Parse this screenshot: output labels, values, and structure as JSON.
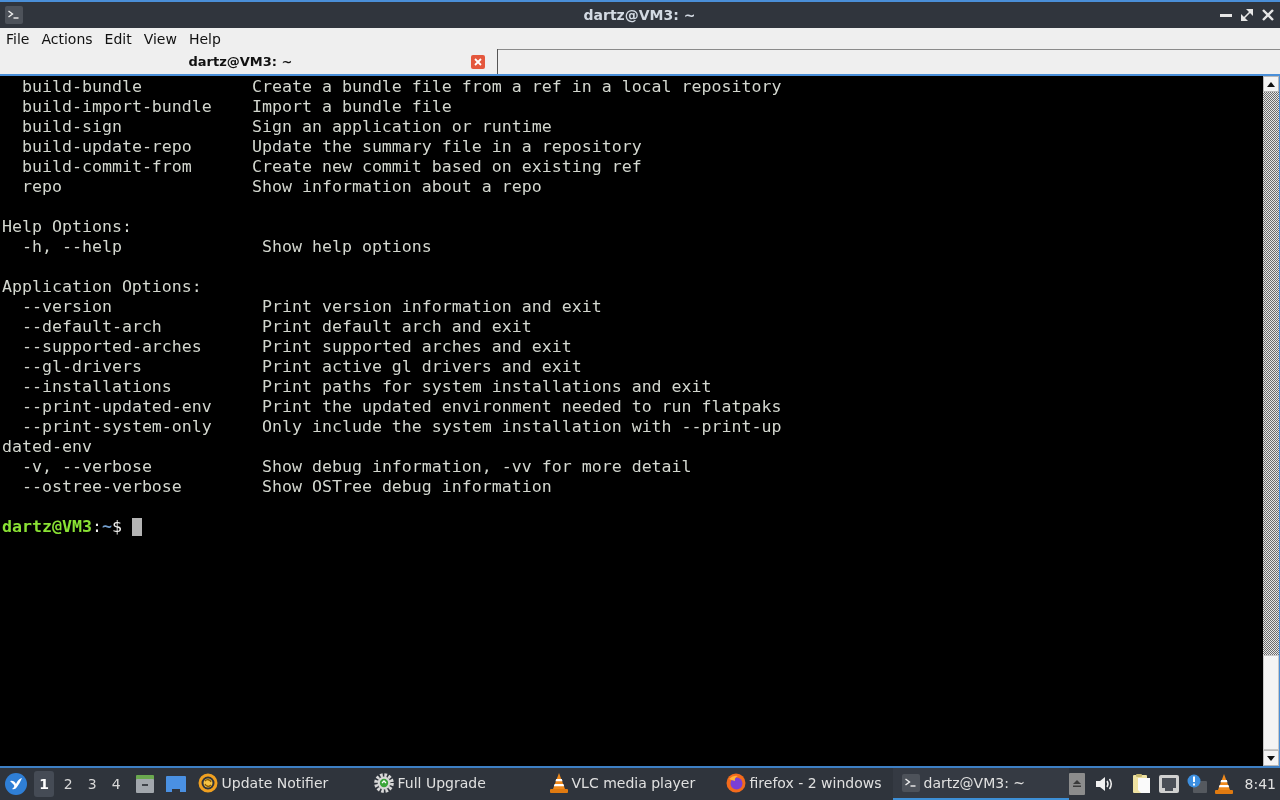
{
  "window": {
    "title": "dartz@VM3: ~"
  },
  "menu": [
    "File",
    "Actions",
    "Edit",
    "View",
    "Help"
  ],
  "tabs": [
    {
      "label": "dartz@VM3: ~",
      "selected": true
    }
  ],
  "terminal": {
    "lines": [
      {
        "kind": "command",
        "name": "build-bundle",
        "description": "Create a bundle file from a ref in a local repository"
      },
      {
        "kind": "command",
        "name": "build-import-bundle",
        "description": "Import a bundle file"
      },
      {
        "kind": "command",
        "name": "build-sign",
        "description": "Sign an application or runtime"
      },
      {
        "kind": "command",
        "name": "build-update-repo",
        "description": "Update the summary file in a repository"
      },
      {
        "kind": "command",
        "name": "build-commit-from",
        "description": "Create new commit based on existing ref"
      },
      {
        "kind": "command",
        "name": "repo",
        "description": "Show information about a repo"
      },
      {
        "kind": "blank"
      },
      {
        "kind": "text",
        "text": "Help Options:"
      },
      {
        "kind": "option",
        "name": "-h, --help",
        "description": "Show help options"
      },
      {
        "kind": "blank"
      },
      {
        "kind": "text",
        "text": "Application Options:"
      },
      {
        "kind": "option",
        "name": "--version",
        "description": "Print version information and exit"
      },
      {
        "kind": "option",
        "name": "--default-arch",
        "description": "Print default arch and exit"
      },
      {
        "kind": "option",
        "name": "--supported-arches",
        "description": "Print supported arches and exit"
      },
      {
        "kind": "option",
        "name": "--gl-drivers",
        "description": "Print active gl drivers and exit"
      },
      {
        "kind": "option",
        "name": "--installations",
        "description": "Print paths for system installations and exit"
      },
      {
        "kind": "option",
        "name": "--print-updated-env",
        "description": "Print the updated environment needed to run flatpaks"
      },
      {
        "kind": "option",
        "name": "--print-system-only",
        "description": "Only include the system installation with --print-up"
      },
      {
        "kind": "text",
        "text": "dated-env"
      },
      {
        "kind": "option",
        "name": "-v, --verbose",
        "description": "Show debug information, -vv for more detail"
      },
      {
        "kind": "option",
        "name": "--ostree-verbose",
        "description": "Show OSTree debug information"
      },
      {
        "kind": "blank"
      }
    ],
    "prompt": {
      "user_host": "dartz@VM3",
      "separator": ":",
      "path": "~",
      "symbol": "$"
    }
  },
  "taskbar": {
    "desktops": [
      {
        "label": "1",
        "selected": true
      },
      {
        "label": "2",
        "selected": false
      },
      {
        "label": "3",
        "selected": false
      },
      {
        "label": "4",
        "selected": false
      }
    ],
    "tasks": [
      {
        "label": "Update Notifier",
        "selected": false
      },
      {
        "label": "Full Upgrade",
        "selected": false
      },
      {
        "label": "VLC media player",
        "selected": false
      },
      {
        "label": "firefox - 2 windows",
        "selected": false
      },
      {
        "label": "dartz@VM3: ~",
        "selected": true
      }
    ],
    "clock": "8:41"
  }
}
